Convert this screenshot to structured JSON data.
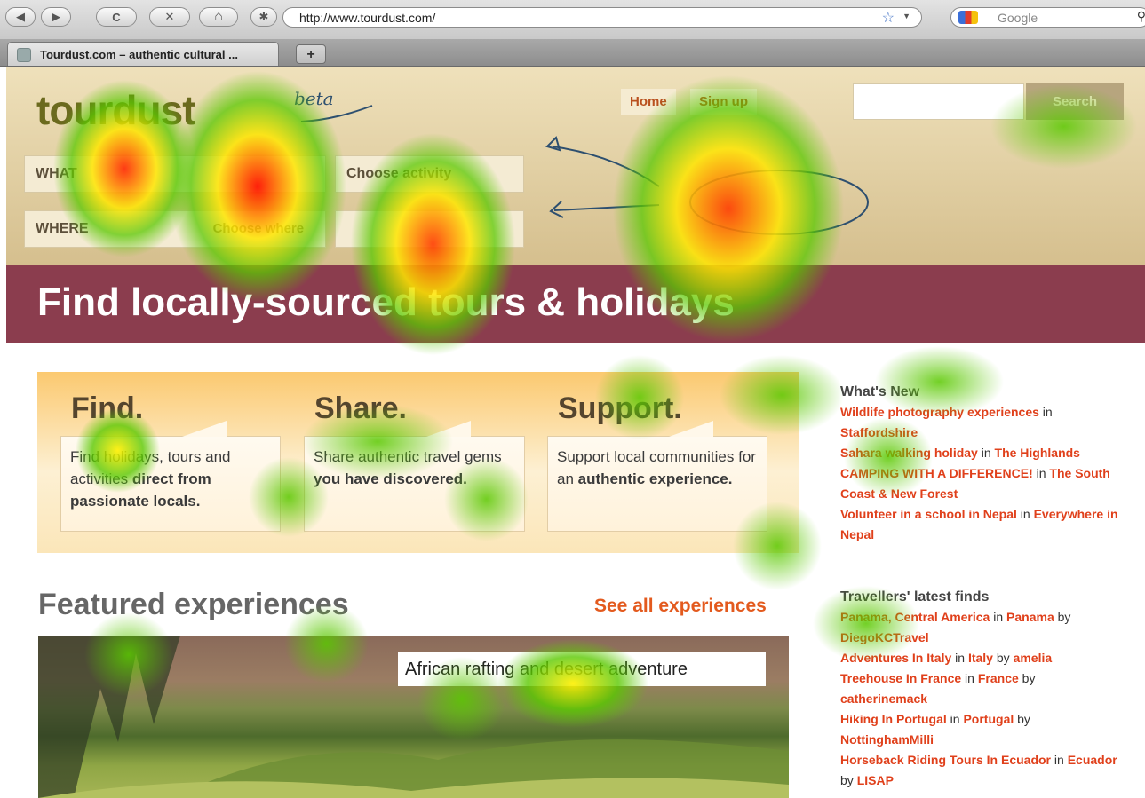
{
  "browser": {
    "url": "http://www.tourdust.com/",
    "search_placeholder": "Google",
    "tab_title": "Tourdust.com – authentic cultural ...",
    "new_tab_label": "+",
    "back_label": "◀",
    "forward_label": "▶",
    "reload_label": "C",
    "stop_label": "✕",
    "home_label": "⌂"
  },
  "header": {
    "logo_text": "tourdust",
    "beta_label": "beta",
    "nav": {
      "home": "Home",
      "signup": "Sign up"
    },
    "search_button": "Search",
    "rows": {
      "what": "WHAT",
      "where": "WHERE",
      "where_placeholder": "Choose where",
      "activity_placeholder": "Choose activity"
    }
  },
  "banner": {
    "title": "Find locally-sourced tours & holidays"
  },
  "promo": {
    "columns": [
      {
        "heading": "Find.",
        "text_a": "Find holidays, tours and activities ",
        "text_b": "direct from passionate locals."
      },
      {
        "heading": "Share.",
        "text_a": "Share authentic travel gems ",
        "text_b": "you have discovered."
      },
      {
        "heading": "Support.",
        "text_a": "Support local communities for an ",
        "text_b": "authentic experience."
      }
    ]
  },
  "featured": {
    "title": "Featured experiences",
    "see_all": "See all experiences",
    "caption": "African rafting and desert adventure"
  },
  "sidebar": {
    "whats_new": {
      "title": "What's New",
      "items": [
        {
          "name": "Wildlife photography experiences",
          "sep": " in ",
          "place": "Staffordshire"
        },
        {
          "name": "Sahara walking holiday",
          "sep": " in ",
          "place": "The Highlands"
        },
        {
          "name": "CAMPING WITH A DIFFERENCE!",
          "sep": " in ",
          "place": "The South Coast & New Forest"
        },
        {
          "name": "Volunteer in a school in Nepal",
          "sep": " in ",
          "place": "Everywhere in Nepal"
        }
      ]
    },
    "travellers": {
      "title": "Travellers' latest finds",
      "items": [
        {
          "name": "Panama, Central America",
          "place": "Panama",
          "by": "DiegoKCTravel"
        },
        {
          "name": "Adventures In Italy",
          "place": "Italy",
          "by": "amelia"
        },
        {
          "name": "Treehouse In France",
          "place": "France",
          "by": "catherinemack"
        },
        {
          "name": "Hiking In Portugal",
          "place": "Portugal",
          "by": "NottinghamMilli"
        },
        {
          "name": "Horseback Riding Tours In Ecuador",
          "place": "Ecuador",
          "by": "LISAP"
        }
      ],
      "in_word": " in ",
      "by_word": " by "
    }
  },
  "colors": {
    "accent": "#e35a1e",
    "banner": "#8b3d4e",
    "header": "#dfcc9e"
  }
}
